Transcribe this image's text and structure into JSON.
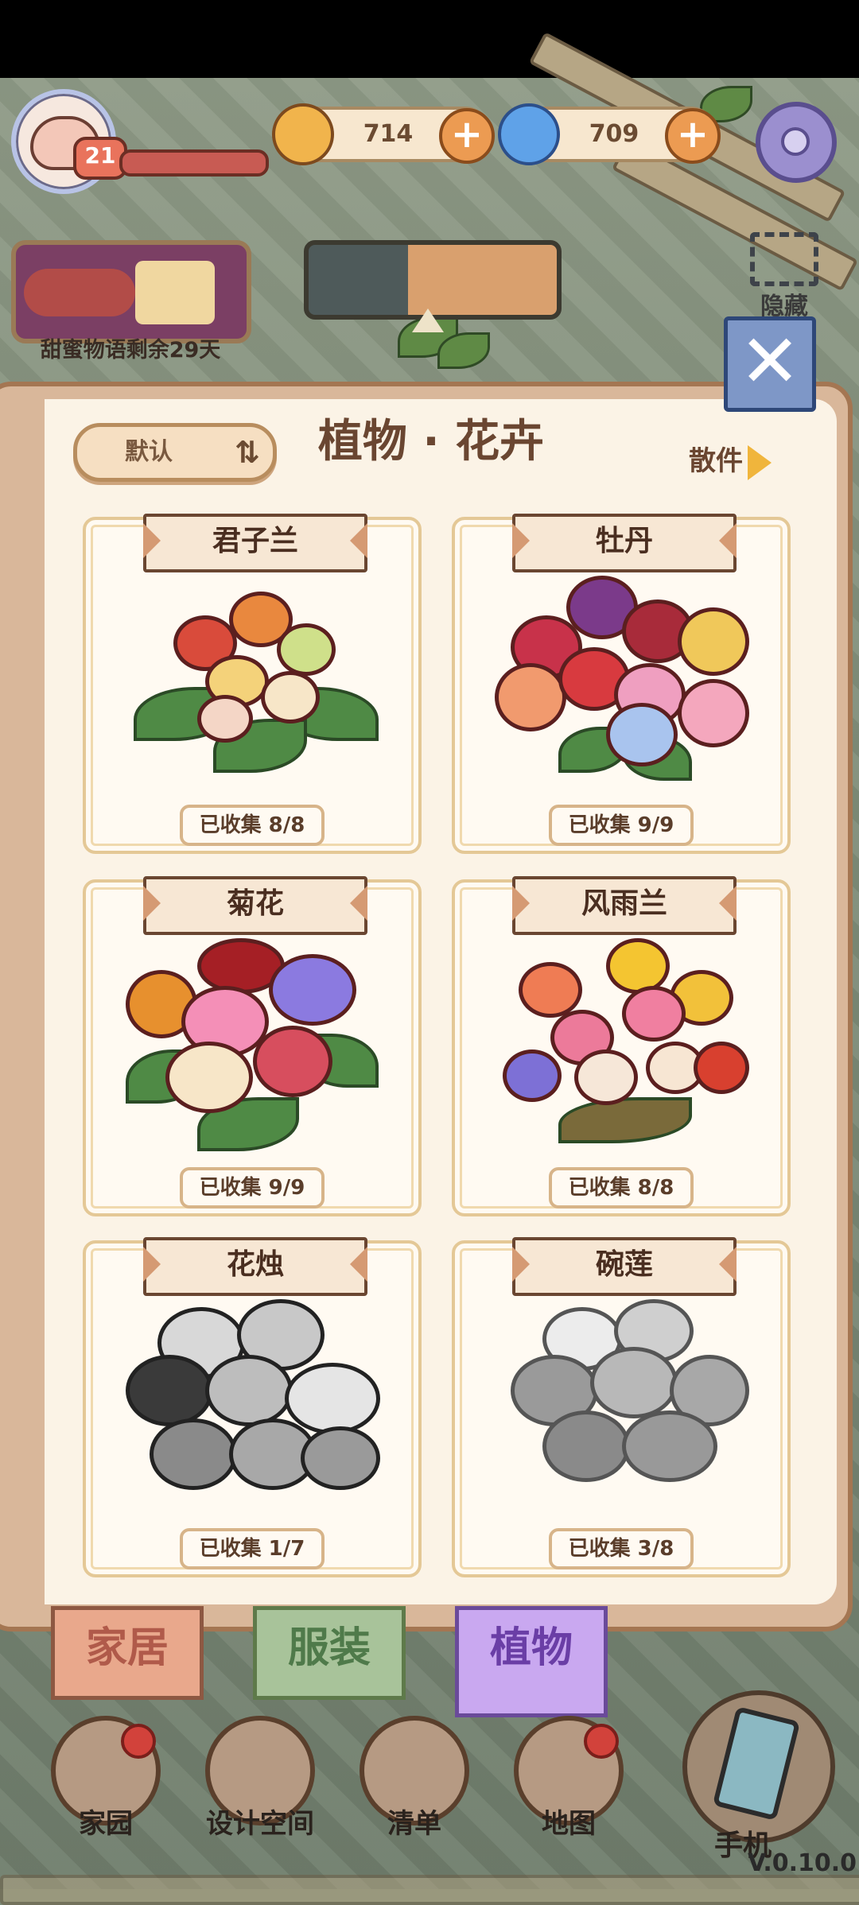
{
  "hud": {
    "level": "21",
    "coins": "714",
    "gems": "709",
    "coin_plus": "+",
    "gem_plus": "+"
  },
  "event": {
    "label": "甜蜜物语剩余29天"
  },
  "hide_button": {
    "label": "隐藏"
  },
  "panel": {
    "title": "植物 · 花卉",
    "sort_label": "默认",
    "sort_icon": "⇅",
    "bulk_label": "散件",
    "close_glyph": "✕"
  },
  "cards": [
    {
      "name": "君子兰",
      "count": "已收集 8/8"
    },
    {
      "name": "牡丹",
      "count": "已收集 9/9"
    },
    {
      "name": "菊花",
      "count": "已收集 9/9"
    },
    {
      "name": "风雨兰",
      "count": "已收集 8/8"
    },
    {
      "name": "花烛",
      "count": "已收集 1/7"
    },
    {
      "name": "碗莲",
      "count": "已收集 3/8"
    }
  ],
  "tabs": {
    "home": "家居",
    "clothes": "服装",
    "plants": "植物"
  },
  "nav": {
    "garden": "家园",
    "design": "设计空间",
    "list": "清单",
    "map": "地图",
    "phone": "手机"
  },
  "version": "V.0.10.0"
}
